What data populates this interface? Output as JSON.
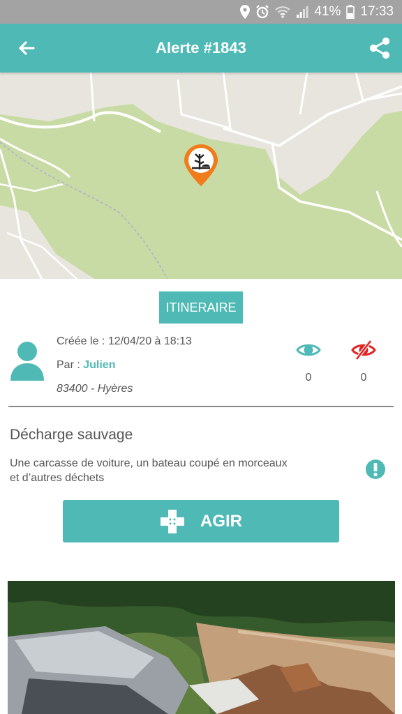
{
  "status_bar": {
    "battery": "41%",
    "time": "17:33",
    "icons": [
      "location-icon",
      "alarm-icon",
      "wifi-icon",
      "signal-icon",
      "battery-icon"
    ]
  },
  "app_bar": {
    "title": "Alerte #1843",
    "back_icon": "arrow-left-icon",
    "share_icon": "share-icon",
    "color": "#4fb9b5"
  },
  "map": {
    "marker_icon": "pollution-marker-icon",
    "marker_color": "#f07c1b"
  },
  "itinerary_button": {
    "label": "ITINERAIRE"
  },
  "alert_info": {
    "created": "Créée le : 12/04/20 à 18:13",
    "author_prefix": "Par : ",
    "author_name": "Julien",
    "location": "83400 - Hyères"
  },
  "stats": {
    "views": "0",
    "hidden": "0",
    "view_icon": "eye-icon",
    "hidden_icon": "eye-slash-icon",
    "hidden_color": "#e02424"
  },
  "alert": {
    "category": "Décharge sauvage",
    "description": "Une carcasse de voiture, un bateau coupé en morceaux et d’autres déchets",
    "report_icon": "exclamation-circle-icon"
  },
  "action_button": {
    "label": "AGIR",
    "icon": "bandage-plus-icon"
  },
  "photo": {
    "subject": "photo-icon"
  }
}
